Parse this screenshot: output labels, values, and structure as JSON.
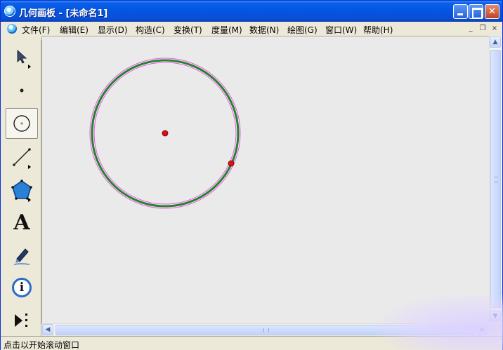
{
  "window": {
    "title": "几何画板 - [未命名1]"
  },
  "title_buttons": {
    "minimize": "minimize",
    "maximize": "maximize",
    "close": "close"
  },
  "menu": {
    "items": [
      {
        "label": "文件(F)"
      },
      {
        "label": "编辑(E)"
      },
      {
        "label": "显示(D)"
      },
      {
        "label": "构造(C)"
      },
      {
        "label": "变换(T)"
      },
      {
        "label": "度量(M)"
      },
      {
        "label": "数据(N)"
      },
      {
        "label": "绘图(G)"
      },
      {
        "label": "窗口(W)"
      },
      {
        "label": "帮助(H)"
      }
    ],
    "mdi_minimize": "_",
    "mdi_restore": "❐",
    "mdi_close": "×"
  },
  "tools": [
    {
      "name": "selection-arrow-icon",
      "selected": false
    },
    {
      "name": "point-tool-icon",
      "selected": false
    },
    {
      "name": "compass-circle-icon",
      "selected": true
    },
    {
      "name": "straightedge-icon",
      "selected": false
    },
    {
      "name": "polygon-icon",
      "selected": false
    },
    {
      "name": "text-tool-icon",
      "label": "A",
      "selected": false
    },
    {
      "name": "marker-pen-icon",
      "selected": false
    },
    {
      "name": "information-icon",
      "label": "i",
      "selected": false
    },
    {
      "name": "custom-tools-icon",
      "selected": false
    }
  ],
  "canvas": {
    "circle_color": "#2e7d32",
    "selection_highlight_color": "#e060e0",
    "point_color": "#e01010"
  },
  "statusbar": {
    "text": "点击以开始滚动窗口"
  }
}
